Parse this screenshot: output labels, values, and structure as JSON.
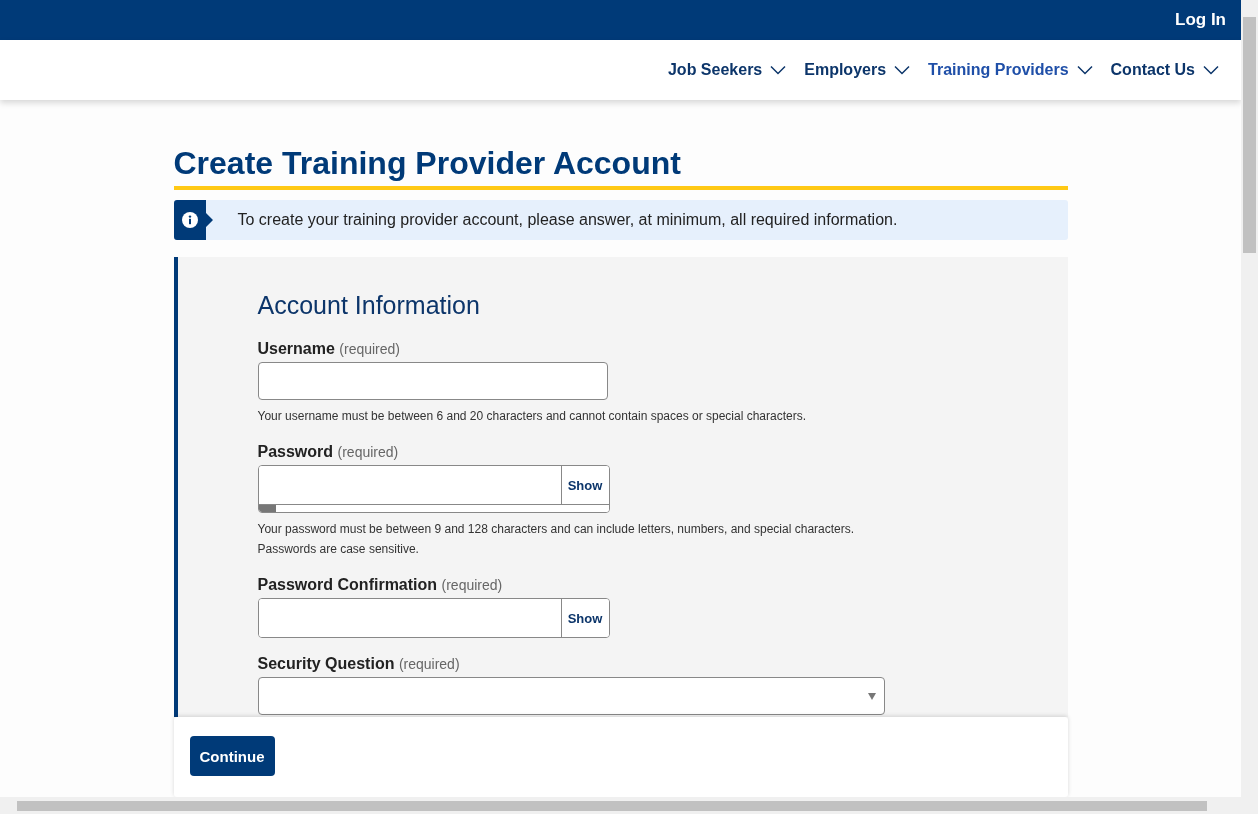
{
  "header": {
    "login": "Log In"
  },
  "nav": [
    {
      "label": "Job Seekers",
      "selected": false
    },
    {
      "label": "Employers",
      "selected": false
    },
    {
      "label": "Training Providers",
      "selected": true
    },
    {
      "label": "Contact Us",
      "selected": false
    }
  ],
  "page": {
    "title": "Create Training Provider Account",
    "notice": "To create your training provider account, please answer, at minimum, all required information."
  },
  "form": {
    "heading": "Account Information",
    "fields": [
      {
        "kind": "text",
        "label": "Username",
        "note": "(required)",
        "help": [
          "Your username must be between 6 and 20 characters and cannot contain spaces or special characters."
        ]
      },
      {
        "kind": "password",
        "label": "Password",
        "note": "(required)",
        "toggle": "Show",
        "strength": {
          "level": 0.05
        },
        "help": [
          "Your password must be between 9 and 128 characters and can include letters, numbers, and special characters.",
          "Passwords are case sensitive."
        ]
      },
      {
        "kind": "password",
        "label": "Password Confirmation",
        "note": "(required)",
        "toggle": "Show"
      },
      {
        "kind": "select",
        "label": "Security Question",
        "note": "(required)"
      }
    ]
  },
  "footer": {
    "continue": "Continue"
  }
}
